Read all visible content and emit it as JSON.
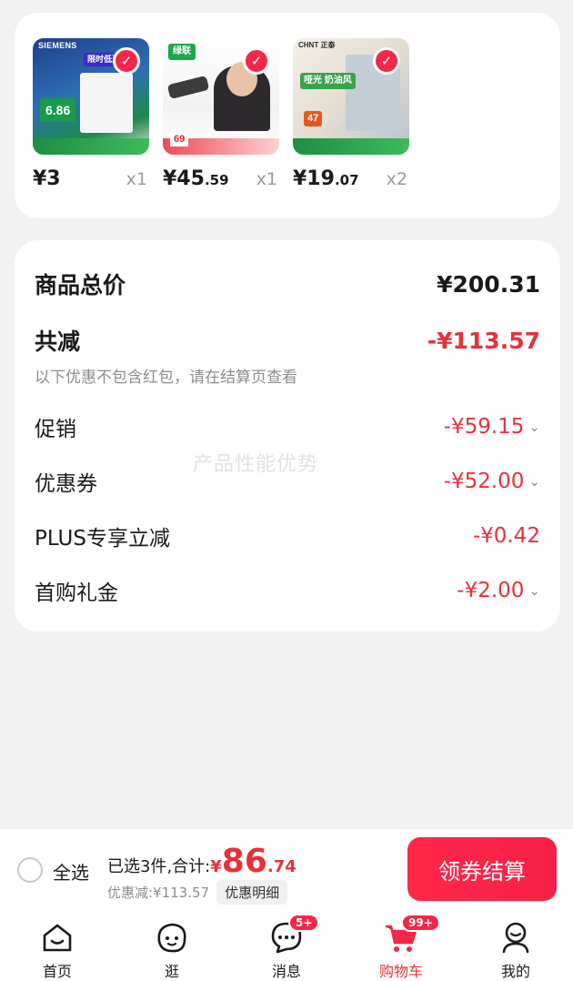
{
  "products": [
    {
      "price_int": "¥3",
      "price_dec": "",
      "qty": "x1",
      "brand": "SIEMENS",
      "promo": "限时低至",
      "tag": "6.86"
    },
    {
      "price_int": "¥45",
      "price_dec": ".59",
      "qty": "x1",
      "brand": "绿联",
      "promo": "",
      "tag": "69"
    },
    {
      "price_int": "¥19",
      "price_dec": ".07",
      "qty": "x2",
      "brand": "CHNT 正泰",
      "promo": "哑光 奶油风",
      "tag": "47"
    }
  ],
  "summary": {
    "total_label": "商品总价",
    "total_value": "¥200.31",
    "discount_label": "共减",
    "discount_value": "-¥113.57",
    "note": "以下优惠不包含红包，请在结算页查看",
    "rows": [
      {
        "label": "促销",
        "value": "-¥59.15",
        "chevron": "⌄"
      },
      {
        "label": "优惠券",
        "value": "-¥52.00",
        "chevron": "⌄"
      },
      {
        "label": "PLUS专享立减",
        "value": "-¥0.42",
        "chevron": ""
      },
      {
        "label": "首购礼金",
        "value": "-¥2.00",
        "chevron": "⌄"
      }
    ],
    "watermark": "产品性能优势"
  },
  "checkout": {
    "select_all": "全选",
    "selected_text": "已选3件,合计:",
    "yen": "¥",
    "total_int": "86",
    "total_dec": ".74",
    "saved_text": "优惠减:¥113.57",
    "detail_button": "优惠明细",
    "checkout_button": "领券结算"
  },
  "tabs": [
    {
      "label": "首页",
      "icon": "home-icon",
      "badge": ""
    },
    {
      "label": "逛",
      "icon": "face-icon",
      "badge": ""
    },
    {
      "label": "消息",
      "icon": "message-icon",
      "badge": "5+"
    },
    {
      "label": "购物车",
      "icon": "cart-icon",
      "badge": "99+"
    },
    {
      "label": "我的",
      "icon": "user-icon",
      "badge": ""
    }
  ],
  "colors": {
    "accent": "#f4264a",
    "discount": "#e8303a"
  }
}
